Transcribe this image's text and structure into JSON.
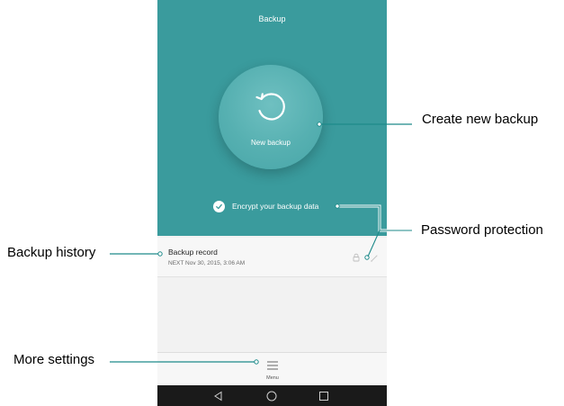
{
  "screen": {
    "title": "Backup",
    "new_backup": {
      "label": "New backup",
      "icon": "refresh-icon"
    },
    "encrypt": {
      "label": "Encrypt your backup data",
      "checked": true,
      "icon": "check-icon"
    },
    "record": {
      "title": "Backup record",
      "subtitle": "NEXT  Nov 30, 2015, 3:06 AM",
      "lock_icon": "lock-icon",
      "edit_icon": "pencil-icon"
    },
    "menu": {
      "label": "Menu",
      "icon": "menu-icon"
    },
    "navbar": {
      "buttons": [
        "back-icon",
        "home-icon",
        "recents-icon"
      ]
    }
  },
  "callouts": {
    "create_new_backup": "Create new backup",
    "password_protection": "Password protection",
    "backup_history": "Backup history",
    "more_settings": "More settings"
  },
  "colors": {
    "header_teal": "#3a9b9d",
    "button_teal": "#56b0b1",
    "background": "#f2f2f2",
    "navbar": "#1a1a1a"
  }
}
